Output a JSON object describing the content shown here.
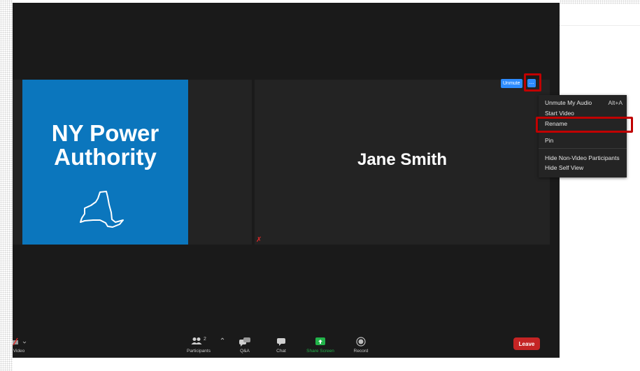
{
  "participants": {
    "left": {
      "logo_line1": "NY Power",
      "logo_line2": "Authority",
      "background": "#0b76bd"
    },
    "right": {
      "name": "Jane Smith"
    }
  },
  "tile_controls": {
    "unmute_label": "Unmute",
    "more_label": "...",
    "more_icon": "ellipsis-icon"
  },
  "context_menu": {
    "items": [
      {
        "label": "Unmute My Audio",
        "hotkey": "Alt+A"
      },
      {
        "label": "Start Video",
        "hotkey": ""
      },
      {
        "label": "Rename",
        "hotkey": ""
      },
      {
        "label": "Pin",
        "hotkey": ""
      },
      {
        "label": "Hide Non-Video Participants",
        "hotkey": ""
      },
      {
        "label": "Hide Self View",
        "hotkey": ""
      }
    ]
  },
  "toolbar": {
    "video_label": "Video",
    "participants_label": "Participants",
    "participants_count": "2",
    "qa_label": "Q&A",
    "chat_label": "Chat",
    "share_label": "Share Screen",
    "record_label": "Record",
    "leave_label": "Leave"
  },
  "colors": {
    "accent_blue": "#2d8cff",
    "leave_red": "#c42424",
    "share_green": "#22b34a",
    "highlight_red": "#c00000"
  }
}
